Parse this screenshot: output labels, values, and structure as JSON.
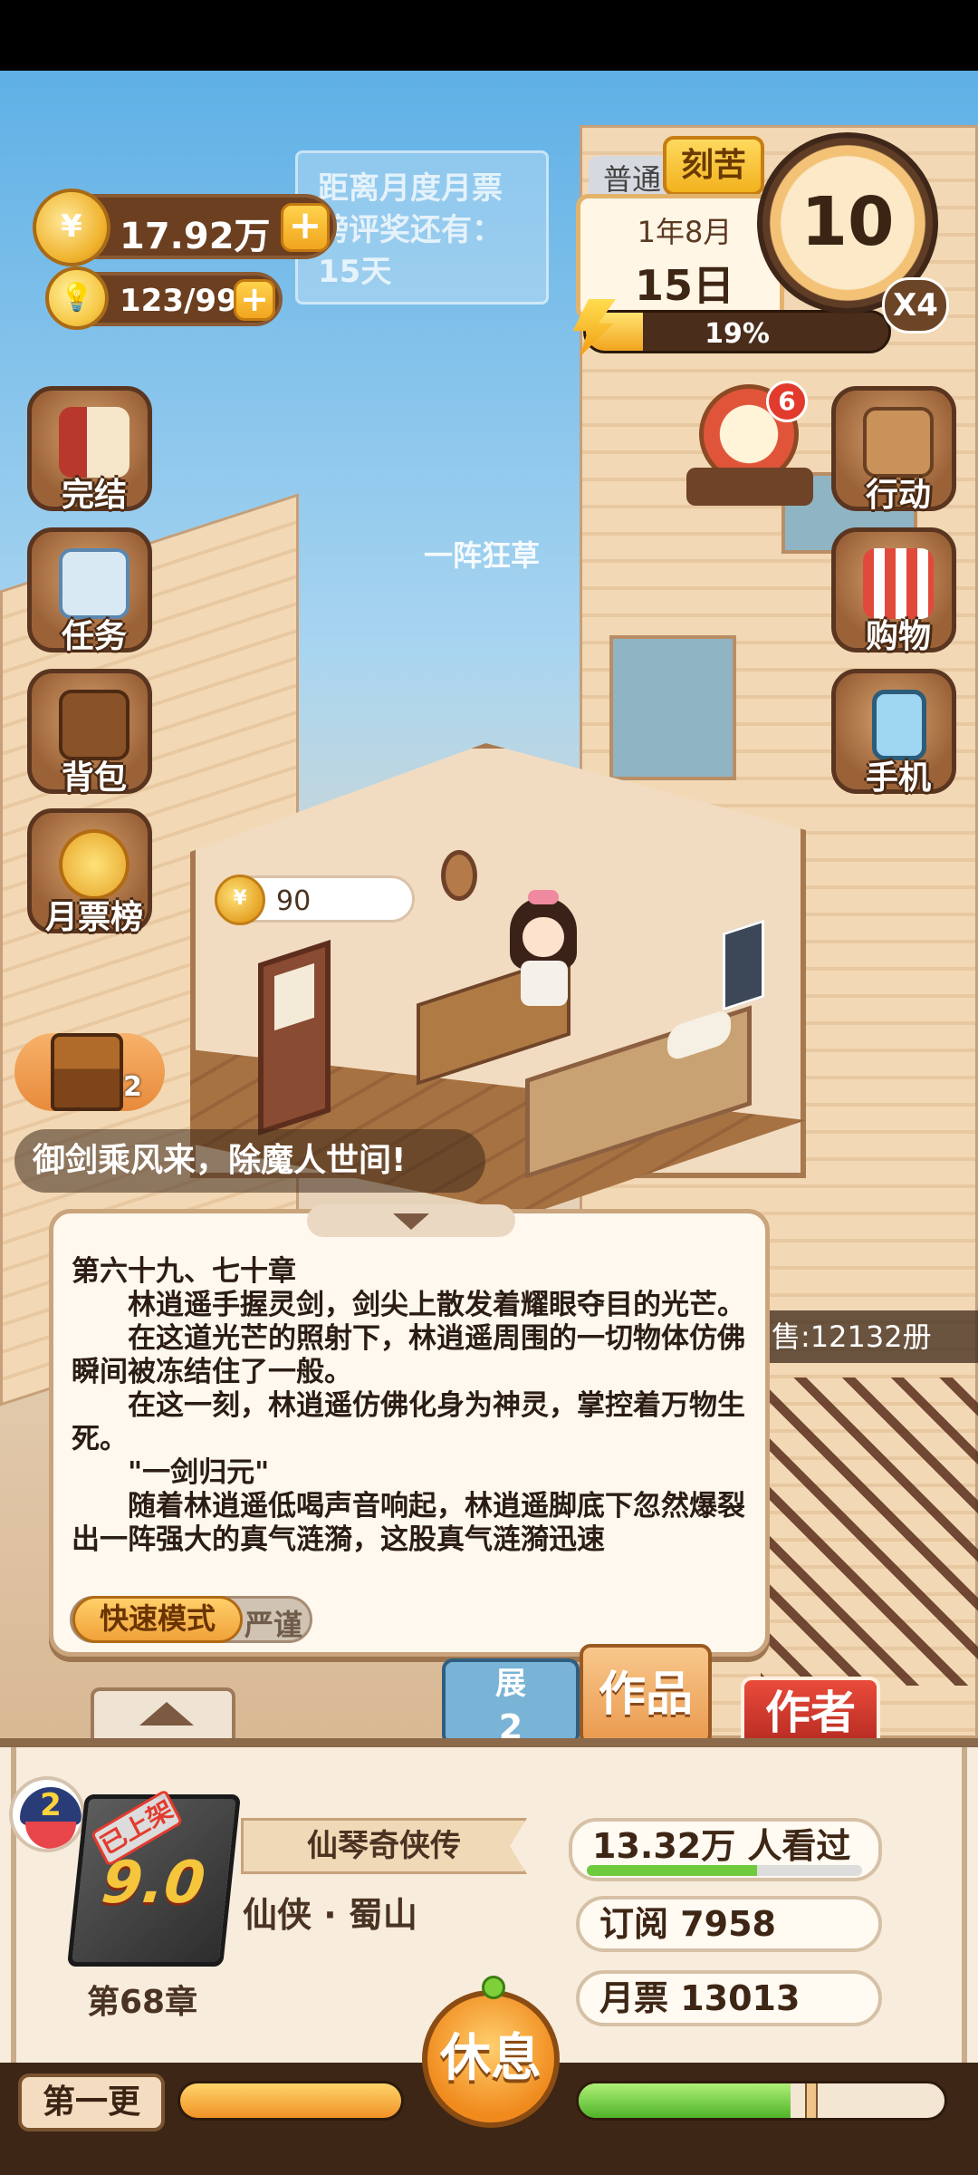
{
  "resources": {
    "coins": "17.92万",
    "coin_icon": "¥",
    "inspiration": "123/999",
    "plus": "+"
  },
  "notice": {
    "text": "距离月度月票榜评奖还有：15天"
  },
  "calendar": {
    "mode_normal": "普通",
    "mode_hard": "刻苦",
    "month": "1年8月",
    "day": "15日",
    "energy_percent": "19%",
    "energy_fraction": 0.19,
    "counter": "10",
    "speed": "X4"
  },
  "side_left": [
    {
      "label": "完结",
      "icon": "book-icon"
    },
    {
      "label": "任务",
      "icon": "task-clipboard-icon"
    },
    {
      "label": "背包",
      "icon": "backpack-icon"
    },
    {
      "label": "月票榜",
      "icon": "monthly-ticket-coin-icon"
    }
  ],
  "side_right": [
    {
      "label": "行动",
      "icon": "door-icon"
    },
    {
      "label": "购物",
      "icon": "shop-icon"
    },
    {
      "label": "手机",
      "icon": "phone-icon"
    }
  ],
  "lucky_wheel": {
    "badge": "6"
  },
  "scene": {
    "floating_text": "一阵狂草",
    "coin_bubble_value": "90"
  },
  "chest": {
    "count": "2"
  },
  "ticker": "御剑乘风来，除魔人世间!",
  "sold": "售:12132册",
  "reader": {
    "chapter_title": "第六十九、七十章",
    "paragraphs": [
      "　　林逍遥手握灵剑，剑尖上散发着耀眼夺目的光芒。",
      "　　在这道光芒的照射下，林逍遥周围的一切物体仿佛瞬间被冻结住了一般。",
      "　　在这一刻，林逍遥仿佛化身为神灵，掌控着万物生死。",
      "　　\"一剑归元\"",
      "　　随着林逍遥低喝声音响起，林逍遥脚底下忽然爆裂出一阵强大的真气涟漪，这股真气涟漪迅速"
    ],
    "mode_fast": "快速模式",
    "mode_strict": "严谨"
  },
  "tabs": {
    "dev_label": "展",
    "dev_count": "2",
    "works": "作品",
    "author": "作者"
  },
  "book": {
    "avatar_level": "2",
    "stamp": "已上架",
    "score": "9.0",
    "chapter": "第68章",
    "title": "仙琴奇侠传",
    "genre": "仙侠 · 蜀山",
    "views": "13.32万 人看过",
    "views_fraction": 0.62,
    "subscriptions": "订阅 7958",
    "tickets": "月票 13013"
  },
  "bottom": {
    "update_label": "第一更",
    "rest_label": "休息",
    "orange_fraction": 1.0,
    "green_fraction": 0.58,
    "green_marker": 0.62
  },
  "colors": {
    "accent_orange": "#f09226",
    "panel_bg": "#f8ecdd",
    "author_red": "#d23a2c",
    "green": "#4fb328"
  }
}
